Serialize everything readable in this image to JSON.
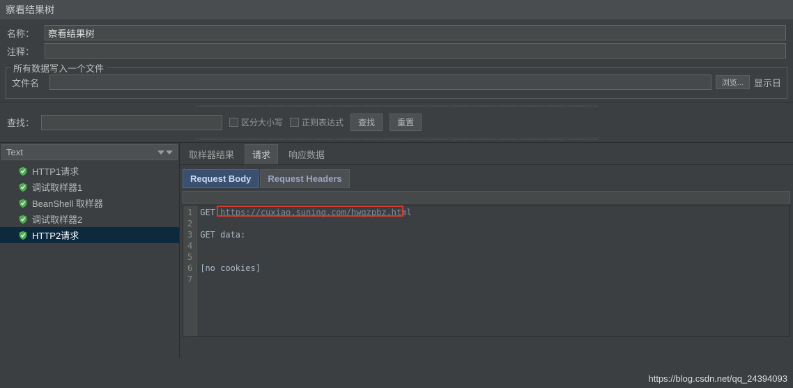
{
  "title": "察看结果树",
  "fields": {
    "name_label": "名称：",
    "name_value": "察看结果树",
    "comment_label": "注释：",
    "comment_value": ""
  },
  "file_section": {
    "legend": "所有数据写入一个文件",
    "filename_label": "文件名",
    "filename_value": "",
    "browse_btn": "浏览...",
    "show_label": "显示日"
  },
  "search": {
    "label": "查找：",
    "value": "",
    "case_label": "区分大小写",
    "regex_label": "正则表达式",
    "find_btn": "查找",
    "reset_btn": "重置"
  },
  "tree": {
    "renderer": "Text",
    "items": [
      {
        "label": "HTTP1请求",
        "selected": false
      },
      {
        "label": "调试取样器1",
        "selected": false
      },
      {
        "label": "BeanShell 取样器",
        "selected": false
      },
      {
        "label": "调试取样器2",
        "selected": false
      },
      {
        "label": "HTTP2请求",
        "selected": true
      }
    ]
  },
  "tabs": {
    "items": [
      {
        "label": "取样器结果",
        "active": false
      },
      {
        "label": "请求",
        "active": true
      },
      {
        "label": "响应数据",
        "active": false
      }
    ],
    "subtabs": [
      {
        "label": "Request Body",
        "active": true
      },
      {
        "label": "Request Headers",
        "active": false
      }
    ]
  },
  "code": {
    "lines": [
      {
        "n": 1,
        "text": "GET https://cuxiao.suning.com/hwgzpbz.html"
      },
      {
        "n": 2,
        "text": ""
      },
      {
        "n": 3,
        "text": "GET data:"
      },
      {
        "n": 4,
        "text": ""
      },
      {
        "n": 5,
        "text": ""
      },
      {
        "n": 6,
        "text": "[no cookies]"
      },
      {
        "n": 7,
        "text": ""
      }
    ],
    "url_part": "https://cuxiao.suning.com/hwgzpbz.html"
  },
  "watermark": "https://blog.csdn.net/qq_24394093"
}
